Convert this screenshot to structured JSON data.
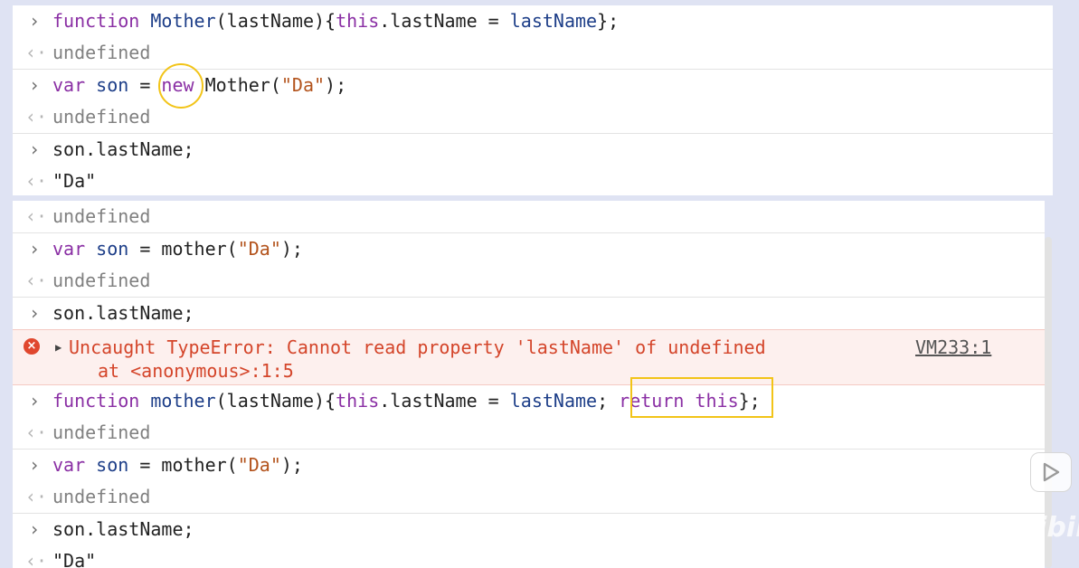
{
  "top_panel": {
    "rows": [
      {
        "kind": "input",
        "code": [
          {
            "t": "function ",
            "c": "kw"
          },
          {
            "t": "Mother",
            "c": "fn"
          },
          {
            "t": "(lastName){"
          },
          {
            "t": "this",
            "c": "kw"
          },
          {
            "t": ".lastName = "
          },
          {
            "t": "lastName",
            "c": "vr"
          },
          {
            "t": "};"
          }
        ]
      },
      {
        "kind": "output",
        "code": [
          {
            "t": "undefined",
            "c": "muted"
          }
        ]
      },
      {
        "kind": "input",
        "code": [
          {
            "t": "var ",
            "c": "kw"
          },
          {
            "t": "son",
            "c": "vr"
          },
          {
            "t": " = "
          },
          {
            "t": "new",
            "c": "kw"
          },
          {
            "t": " Mother("
          },
          {
            "t": "\"Da\"",
            "c": "str"
          },
          {
            "t": ");"
          }
        ]
      },
      {
        "kind": "output",
        "code": [
          {
            "t": "undefined",
            "c": "muted"
          }
        ]
      },
      {
        "kind": "input",
        "code": [
          {
            "t": "son.lastName;"
          }
        ]
      },
      {
        "kind": "output",
        "code": [
          {
            "t": "\"Da\""
          }
        ]
      }
    ]
  },
  "bottom_panel": {
    "rows_before_error": [
      {
        "kind": "output",
        "code": [
          {
            "t": "undefined",
            "c": "muted"
          }
        ]
      },
      {
        "kind": "input",
        "code": [
          {
            "t": "var ",
            "c": "kw"
          },
          {
            "t": "son",
            "c": "vr"
          },
          {
            "t": " = mother("
          },
          {
            "t": "\"Da\"",
            "c": "str"
          },
          {
            "t": ");"
          }
        ]
      },
      {
        "kind": "output",
        "code": [
          {
            "t": "undefined",
            "c": "muted"
          }
        ]
      },
      {
        "kind": "input",
        "code": [
          {
            "t": "son.lastName;"
          }
        ]
      }
    ],
    "error": {
      "icon": "error-icon",
      "message": "Uncaught TypeError: Cannot read property 'lastName' of undefined",
      "stack": "at <anonymous>:1:5",
      "source_link": "VM233:1"
    },
    "rows_after_error": [
      {
        "kind": "input",
        "code": [
          {
            "t": "function ",
            "c": "kw"
          },
          {
            "t": "mother",
            "c": "fn"
          },
          {
            "t": "(lastName){"
          },
          {
            "t": "this",
            "c": "kw"
          },
          {
            "t": ".lastName = "
          },
          {
            "t": "lastName",
            "c": "vr"
          },
          {
            "t": "; "
          },
          {
            "t": "return",
            "c": "kw"
          },
          {
            "t": " "
          },
          {
            "t": "this",
            "c": "kw"
          },
          {
            "t": "};"
          }
        ]
      },
      {
        "kind": "output",
        "code": [
          {
            "t": "undefined",
            "c": "muted"
          }
        ]
      },
      {
        "kind": "input",
        "code": [
          {
            "t": "var ",
            "c": "kw"
          },
          {
            "t": "son",
            "c": "vr"
          },
          {
            "t": " = mother("
          },
          {
            "t": "\"Da\"",
            "c": "str"
          },
          {
            "t": ");"
          }
        ]
      },
      {
        "kind": "output",
        "code": [
          {
            "t": "undefined",
            "c": "muted"
          }
        ]
      },
      {
        "kind": "input",
        "code": [
          {
            "t": "son.lastName;"
          }
        ]
      },
      {
        "kind": "output",
        "code": [
          {
            "t": "\"Da\""
          }
        ]
      }
    ]
  },
  "glyphs": {
    "input_arrow": "›",
    "output_arrow": "‹·",
    "error_x": "×",
    "expand": "▶"
  },
  "colors": {
    "keyword": "#8a2fa4",
    "identifier": "#1d3e88",
    "string": "#b3531c",
    "error": "#d4452a",
    "highlight": "#f2c418"
  },
  "watermark": "bilibili"
}
